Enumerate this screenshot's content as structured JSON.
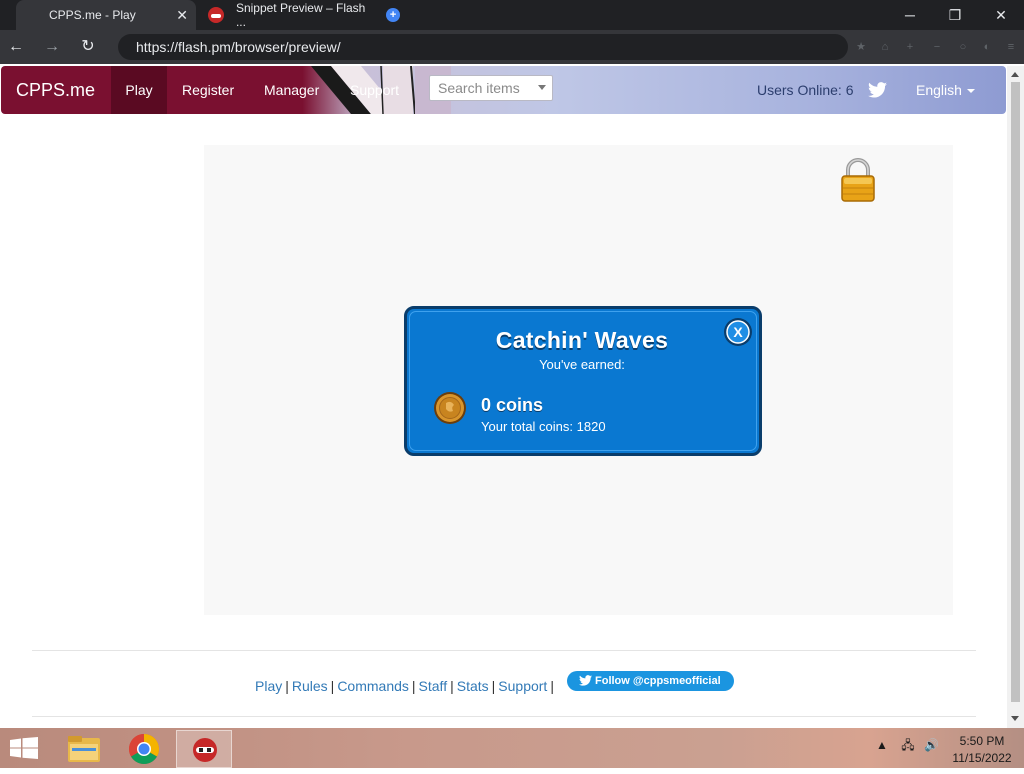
{
  "browser": {
    "tabs": [
      {
        "title": "CPPS.me - Play",
        "active": true
      },
      {
        "title": "Snippet Preview – Flash ...",
        "active": false
      }
    ],
    "url": "https://flash.pm/browser/preview/",
    "close_glyph": "✕",
    "window_controls": {
      "minimize": "─",
      "maximize": "❐",
      "close": "✕"
    },
    "nav": {
      "back": "←",
      "forward": "→",
      "reload": "↻"
    }
  },
  "navbar": {
    "brand": "CPPS.me",
    "links": [
      "Play",
      "Register",
      "Manager",
      "Support"
    ],
    "active_link": "Play",
    "search_placeholder": "Search items",
    "users_online": "Users Online: 6",
    "language": "English",
    "brand_color": "#7a1030"
  },
  "popup": {
    "title": "Catchin' Waves",
    "earned_label": "You've earned:",
    "coins_earned": "0 coins",
    "total_coins": "Your total coins: 1820",
    "close_label": "X",
    "background_color": "#0a78d1"
  },
  "footer": {
    "links": [
      "Play",
      "Rules",
      "Commands",
      "Staff",
      "Stats",
      "Support"
    ],
    "follow_button": "Follow @cppsmeofficial"
  },
  "taskbar": {
    "time": "5:50 PM",
    "date": "11/15/2022"
  },
  "icons": {
    "lock": "lock-icon",
    "coin": "coin-icon",
    "twitter": "twitter-icon"
  }
}
